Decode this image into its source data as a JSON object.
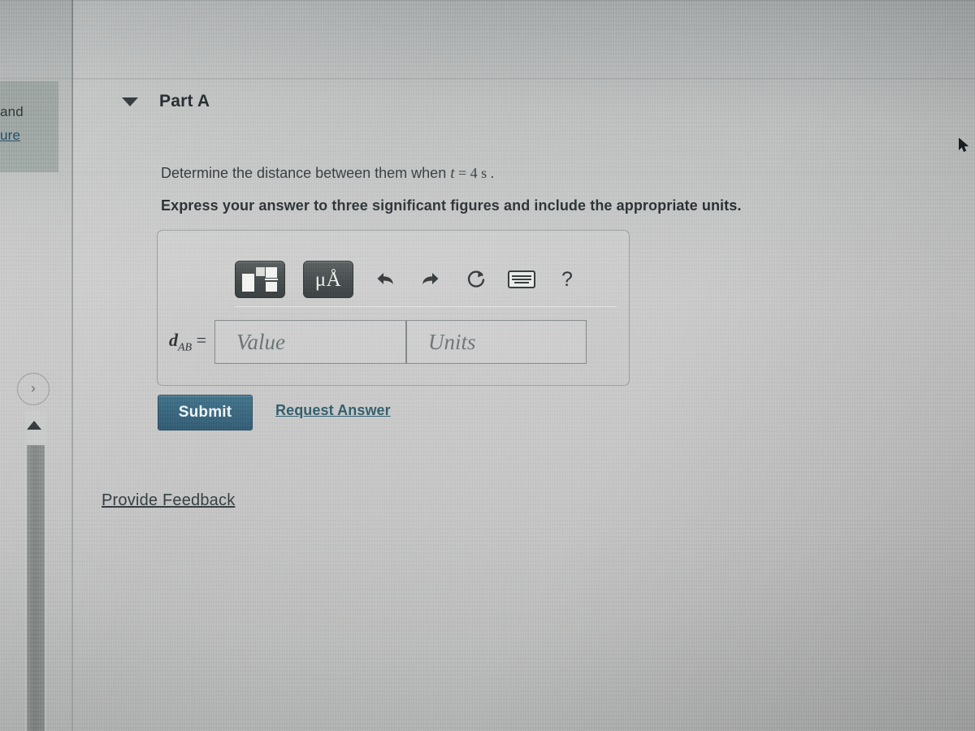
{
  "sidebar": {
    "clipped_text": "and",
    "clipped_link": "ure",
    "expand_chevron": "›",
    "scroll_up_arrow": "scroll-up-arrow"
  },
  "part": {
    "caret": "collapse-caret",
    "title": "Part A",
    "question": "Determine the distance between them when ",
    "question_var": "t",
    "question_eq": " = 4 s .",
    "instruction": "Express your answer to three significant figures and include the appropriate units."
  },
  "toolbar": {
    "template_button": "math-template",
    "units_button": "μÅ",
    "undo_button": "⬅",
    "redo_button": "➡",
    "reset_button": "↻",
    "keyboard_button": "keyboard",
    "help_button": "?"
  },
  "answer": {
    "variable": "d",
    "subscript": "AB",
    "equals": " = ",
    "value_placeholder": "Value",
    "units_placeholder": "Units"
  },
  "actions": {
    "submit_label": "Submit",
    "request_answer_label": "Request Answer",
    "provide_feedback_label": "Provide Feedback"
  },
  "colors": {
    "submit_bg": "#2e5e77",
    "link": "#20505f",
    "text": "#20262a",
    "toolbar_dark": "#32393a"
  }
}
